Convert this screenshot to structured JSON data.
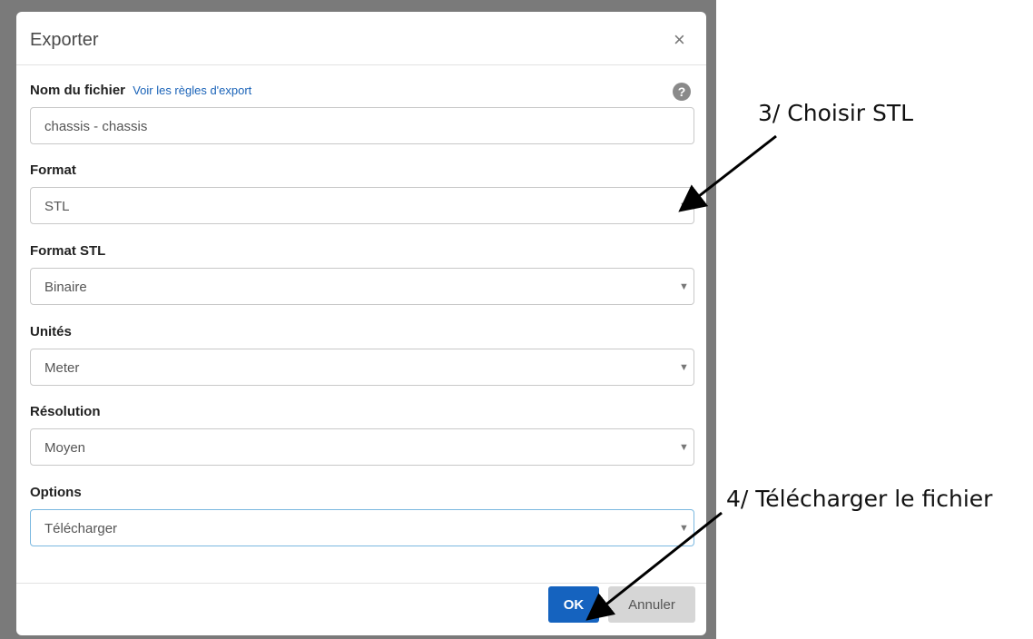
{
  "dialog": {
    "title": "Exporter",
    "close_icon": "close-icon",
    "file_name": {
      "label": "Nom du fichier",
      "link": "Voir les règles d'export",
      "help_icon": "question-circle-icon",
      "value": "chassis - chassis"
    },
    "format": {
      "label": "Format",
      "value": "STL"
    },
    "stl_format": {
      "label": "Format STL",
      "value": "Binaire"
    },
    "units": {
      "label": "Unités",
      "value": "Meter"
    },
    "resolution": {
      "label": "Résolution",
      "value": "Moyen"
    },
    "options": {
      "label": "Options",
      "value": "Télécharger"
    },
    "ok_label": "OK",
    "cancel_label": "Annuler"
  },
  "annotations": {
    "step3": "3/ Choisir STL",
    "step4": "4/ Télécharger le fichier"
  },
  "colors": {
    "primary": "#1563bf",
    "link": "#1a63b8",
    "backdrop": "#7a7a7a",
    "focus_border": "#7ab8e0"
  }
}
